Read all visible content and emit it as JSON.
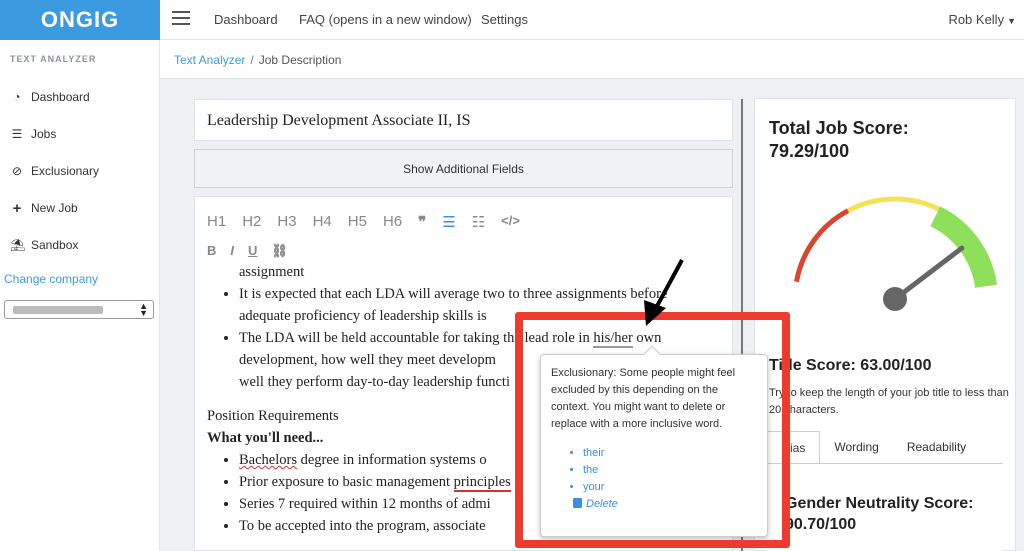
{
  "brand": {
    "logo": "ONGIG",
    "color": "#3c9be0"
  },
  "topnav": {
    "items": [
      "Dashboard",
      "FAQ (opens in a new window)",
      "Settings"
    ],
    "user": "Rob Kelly"
  },
  "sidebar": {
    "section": "TEXT ANALYZER",
    "items": [
      {
        "label": "Dashboard",
        "icon": "dashboard-gauge-icon"
      },
      {
        "label": "Jobs",
        "icon": "list-icon"
      },
      {
        "label": "Exclusionary",
        "icon": "ban-icon"
      },
      {
        "label": "New Job",
        "icon": "plus-icon"
      },
      {
        "label": "Sandbox",
        "icon": "beach-umbrella-icon"
      }
    ],
    "change_company": "Change company"
  },
  "breadcrumb": {
    "parent": "Text Analyzer",
    "separator": "/",
    "current": "Job Description"
  },
  "editor": {
    "job_title": "Leadership Development Associate II, IS",
    "show_fields": "Show Additional Fields",
    "toolbar_headings": [
      "H1",
      "H2",
      "H3",
      "H4",
      "H5",
      "H6"
    ],
    "content": {
      "line0": "assignment",
      "b1_a": "It is expected that each LDA will average two to three assignments before",
      "b1_b": "adequate proficiency of leadership skills is",
      "b2_a": "The LDA will be held accountable for taking the lead role in ",
      "b2_flag": "his/her",
      "b2_b": " own",
      "b2_c": "development, how well they meet developm",
      "b2_d": "well they perform day-to-day leadership functi",
      "section_head": "Position Requirements",
      "need_head": "What you'll need...",
      "r1_flag": "Bachelors",
      "r1": " degree in information systems o",
      "r2_a": "Prior exposure to basic management ",
      "r2_flag": "principles",
      "r3": "Series 7 required within 12 months of admi",
      "r4": "To be accepted into the program, associate"
    }
  },
  "score": {
    "total_label": "Total Job Score:",
    "total_value": "79.29/100",
    "gauge_value": 79.29,
    "gauge_colors": {
      "low": "#d9452f",
      "mid": "#f4e15a",
      "high": "#8ee05a"
    },
    "title_score_label": "Title Score: 63.00/100",
    "title_hint": "Try to keep the length of your job title to less than 20 characters.",
    "tabs": [
      "Bias",
      "Wording",
      "Readability"
    ],
    "gender_label": "Gender Neutrality Score:",
    "gender_value": "90.70/100"
  },
  "tooltip": {
    "message": "Exclusionary: Some people might feel excluded by this depending on the context. You might want to delete or replace with a more inclusive word.",
    "suggestions": [
      "their",
      "the",
      "your"
    ],
    "delete_label": "Delete"
  },
  "colors": {
    "highlight": "#ee3b2f",
    "accent": "#3c8ee0"
  }
}
